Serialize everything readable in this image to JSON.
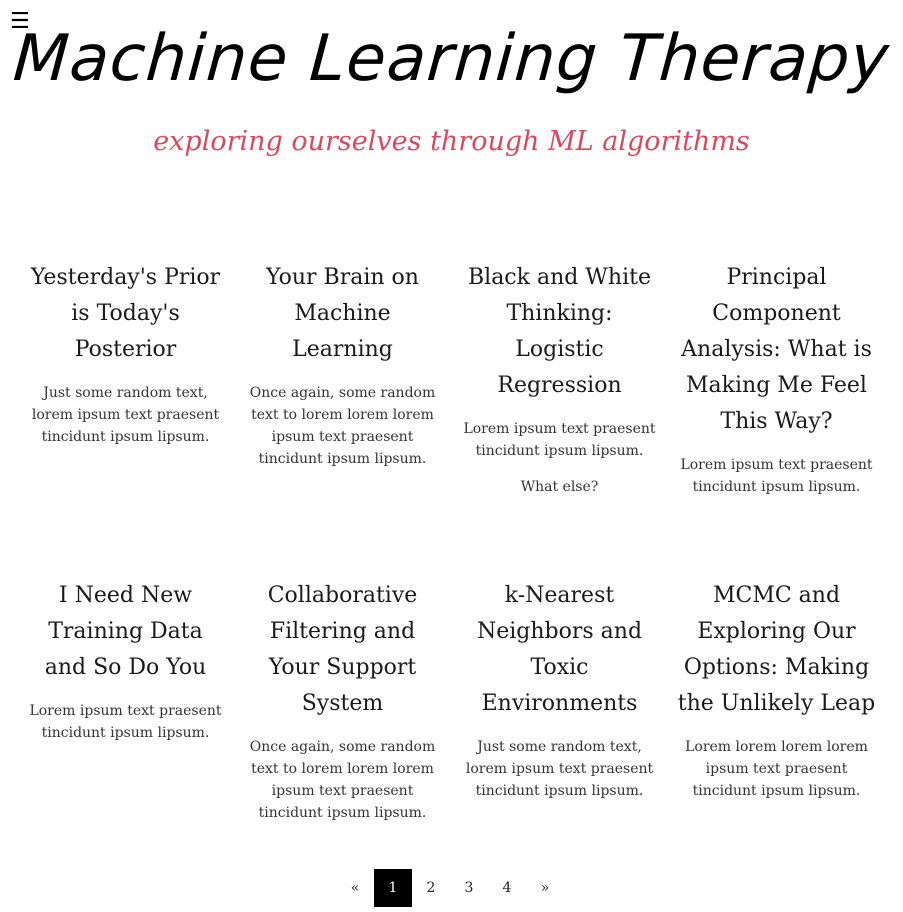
{
  "nav": {
    "menu_icon": "☰"
  },
  "header": {
    "title": "Machine Learning Therapy",
    "subtitle": "exploring ourselves through ML algorithms"
  },
  "posts": [
    {
      "title": "Yesterday's Prior is Today's Posterior",
      "excerpt": "Just some random text, lorem ipsum text praesent tincidunt ipsum lipsum.",
      "extra": ""
    },
    {
      "title": "Your Brain on Machine Learning",
      "excerpt": "Once again, some random text to lorem lorem lorem ipsum text praesent tincidunt ipsum lipsum.",
      "extra": ""
    },
    {
      "title": "Black and White Thinking: Logistic Regression",
      "excerpt": "Lorem ipsum text praesent tincidunt ipsum lipsum.",
      "extra": "What else?"
    },
    {
      "title": "Principal Component Analysis: What is Making Me Feel This Way?",
      "excerpt": "Lorem ipsum text praesent tincidunt ipsum lipsum.",
      "extra": ""
    },
    {
      "title": "I Need New Training Data and So Do You",
      "excerpt": "Lorem ipsum text praesent tincidunt ipsum lipsum.",
      "extra": ""
    },
    {
      "title": "Collaborative Filtering and Your Support System",
      "excerpt": "Once again, some random text to lorem lorem lorem ipsum text praesent tincidunt ipsum lipsum.",
      "extra": ""
    },
    {
      "title": "k-Nearest Neighbors and Toxic Environments",
      "excerpt": "Just some random text, lorem ipsum text praesent tincidunt ipsum lipsum.",
      "extra": ""
    },
    {
      "title": "MCMC and Exploring Our Options: Making the Unlikely Leap",
      "excerpt": "Lorem lorem lorem lorem ipsum text praesent tincidunt ipsum lipsum.",
      "extra": ""
    }
  ],
  "pagination": {
    "prev": "«",
    "pages": [
      "1",
      "2",
      "3",
      "4"
    ],
    "next": "»",
    "current": "1"
  }
}
